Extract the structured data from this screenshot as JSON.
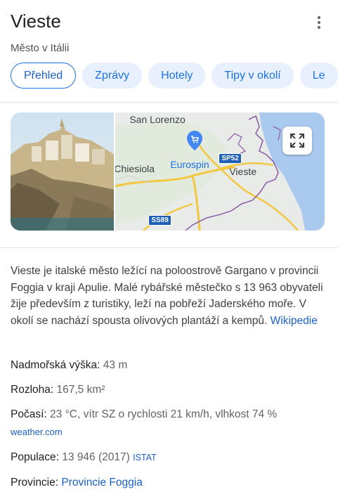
{
  "header": {
    "title": "Vieste",
    "subtitle": "Město v Itálii"
  },
  "tabs": [
    {
      "label": "Přehled"
    },
    {
      "label": "Zprávy"
    },
    {
      "label": "Hotely"
    },
    {
      "label": "Tipy v okolí"
    },
    {
      "label": "Le"
    }
  ],
  "map": {
    "labels": {
      "town1": "San Lorenzo",
      "town2": "Chiesiola",
      "town3": "Vieste",
      "poi": "Eurospin"
    },
    "roads": {
      "sp52": "SP52",
      "ss89": "SS89"
    }
  },
  "description": {
    "text": "Vieste je italské město ležící na poloostrově Gargano v provincii Foggia v kraji Apulie. Malé rybářské městečko s 13 963 obyvateli žije především z turistiky, leží na pobřeží Jaderského moře. V okolí se nachází spousta olivových plantáží a kempů.",
    "source": "Wikipedie"
  },
  "facts": {
    "elevation": {
      "label": "Nadmořská výška:",
      "value": "43 m"
    },
    "area": {
      "label": "Rozloha:",
      "value": "167,5 km²"
    },
    "weather": {
      "label": "Počasí:",
      "value": "23 °C, vítr SZ o rychlosti 21 km/h, vlhkost 74 %",
      "source": "weather.com"
    },
    "population": {
      "label": "Populace:",
      "value": "13 946 (2017)",
      "source": "ISTAT"
    },
    "province": {
      "label": "Provincie:",
      "value": "Provincie Foggia"
    }
  },
  "colors": {
    "accent": "#1a73e8",
    "chip_bg": "#e8f0fe",
    "map_road_yellow": "#f3c742",
    "map_boundary": "#8e63a8"
  }
}
